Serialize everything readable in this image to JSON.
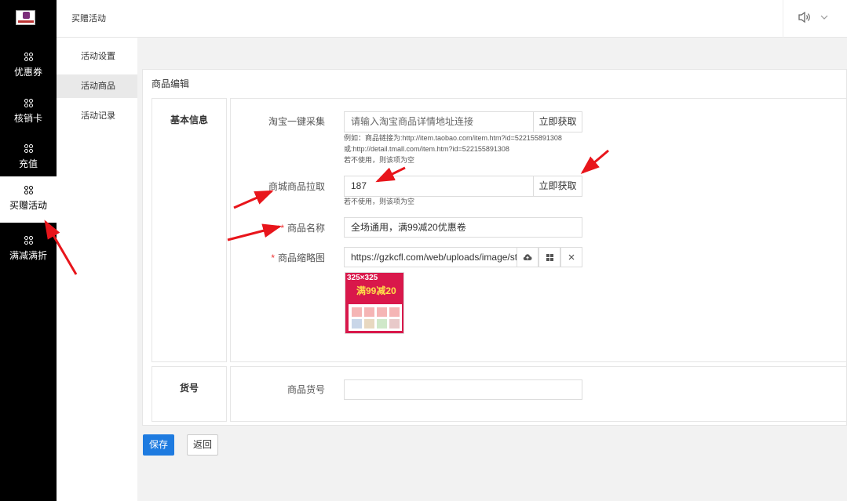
{
  "nav": {
    "items": [
      {
        "label": "优惠券"
      },
      {
        "label": "核销卡"
      },
      {
        "label": "充值"
      },
      {
        "label": "买赠活动"
      },
      {
        "label": "满减满折"
      }
    ]
  },
  "header": {
    "title": "买赠活动"
  },
  "submenu": {
    "items": [
      {
        "label": "活动设置"
      },
      {
        "label": "活动商品"
      },
      {
        "label": "活动记录"
      }
    ]
  },
  "panel": {
    "title": "商品编辑"
  },
  "section_basic": {
    "label": "基本信息",
    "taobao": {
      "label": "淘宝一键采集",
      "placeholder": "请输入淘宝商品详情地址连接",
      "button": "立即获取",
      "help1": "例如：商品链接为:http://item.taobao.com/item.htm?id=522155891308",
      "help2": "或:http://detail.tmall.com/item.htm?id=522155891308",
      "help3": "若不使用，则该项为空"
    },
    "mall": {
      "label": "商城商品拉取",
      "value": "187",
      "button": "立即获取",
      "help": "若不使用，则该项为空"
    },
    "name": {
      "label": "商品名称",
      "value": "全场通用，满99减20优惠卷"
    },
    "thumb": {
      "label": "商品缩略图",
      "value": "https://gzkcfl.com/web/uploads/image/sto",
      "image_text1": "325×325",
      "image_text2": "满99减20"
    }
  },
  "section_sku": {
    "label": "货号",
    "field": {
      "label": "商品货号",
      "value": ""
    }
  },
  "actions": {
    "save": "保存",
    "back": "返回"
  },
  "colors": {
    "primary": "#1e7be0",
    "arrow": "#e8151b",
    "nav_bg": "#000000"
  }
}
